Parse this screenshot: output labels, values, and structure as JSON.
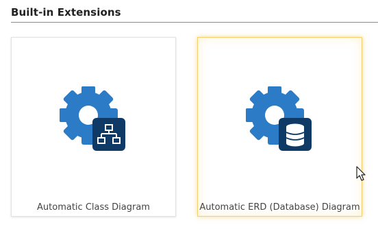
{
  "section": {
    "title": "Built-in Extensions"
  },
  "extensions": [
    {
      "label": "Automatic Class Diagram",
      "icon": "class-diagram-icon",
      "state": "normal"
    },
    {
      "label": "Automatic ERD (Database) Diagram",
      "icon": "database-icon",
      "state": "hover"
    }
  ],
  "colors": {
    "gear": "#2b7bc6",
    "badge": "#0f3a66",
    "hover_border": "#f2cf70",
    "divider": "#8a8a8a"
  }
}
